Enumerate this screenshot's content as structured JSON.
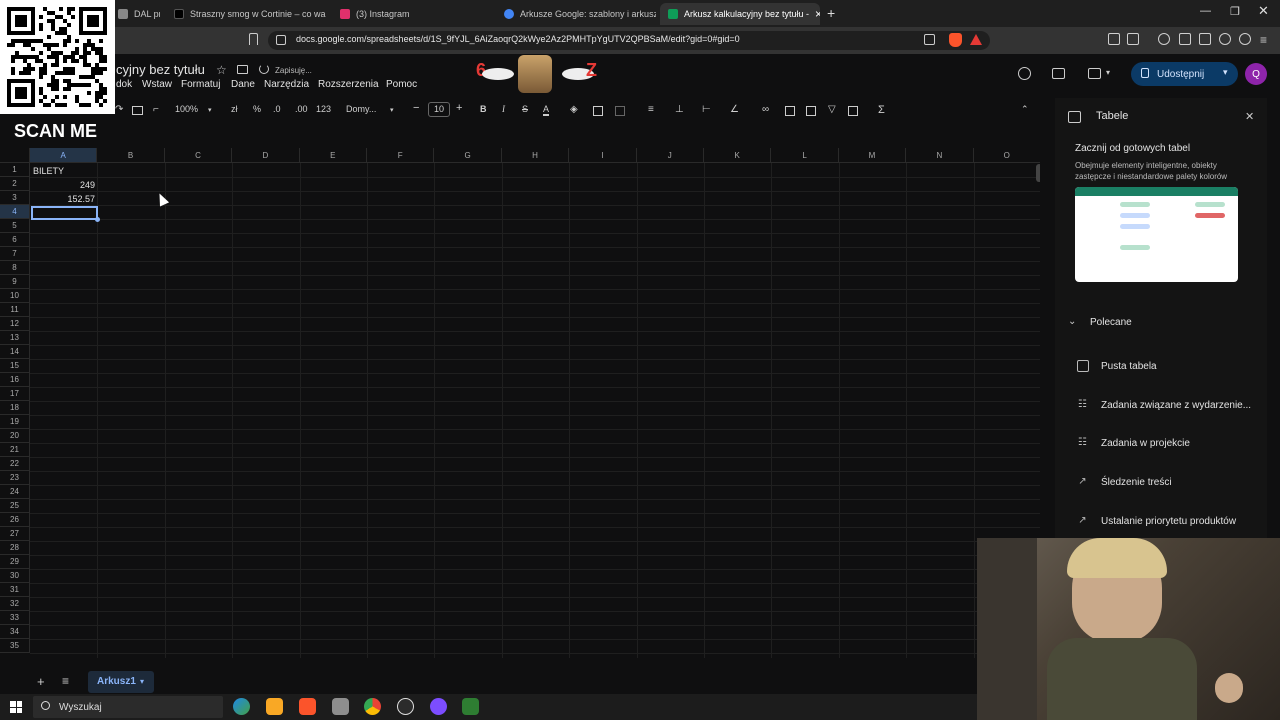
{
  "browser": {
    "tabs": [
      {
        "label": "DAL prod. (",
        "color": "#888888"
      },
      {
        "label": "Straszny smog w Cortinie – co warto",
        "color": "#000000"
      },
      {
        "label": "(3) Instagram",
        "color": "#e1306c"
      },
      {
        "label": "Arkusze Google: szablony i arkusze k",
        "color": "#4285f4"
      },
      {
        "label": "Arkusz kalkulacyjny bez tytułu - ",
        "color": "#0f9d58"
      }
    ],
    "url": "docs.google.com/spreadsheets/d/1S_9fYJL_6AiZaoqrQ2kWye2Az2PMHTpYgUTV2QPBSaM/edit?gid=0#gid=0",
    "new_tab": "+",
    "close_tab": "×"
  },
  "doc": {
    "title": "cyjny bez tytułu",
    "saving": "Zapisuję...",
    "share": "Udostępnij",
    "avatar": "Q",
    "menus": [
      "dok",
      "Wstaw",
      "Formatuj",
      "Dane",
      "Narzędzia",
      "Rozszerzenia",
      "Pomoc"
    ]
  },
  "toolbar": {
    "zoom": "100%",
    "currency": "zł",
    "percent": "%",
    "dec_minus": ".0",
    "dec_plus": ".00",
    "format123": "123",
    "font": "Domy...",
    "minus": "−",
    "font_size": "10",
    "plus": "+",
    "bold": "B",
    "italic": "I",
    "strike": "S",
    "textcolor": "A",
    "sigma": "Σ"
  },
  "grid": {
    "columns": [
      "A",
      "B",
      "C",
      "D",
      "E",
      "F",
      "G",
      "H",
      "I",
      "J",
      "K",
      "L",
      "M",
      "N",
      "O"
    ],
    "rows": [
      "1",
      "2",
      "3",
      "4",
      "5",
      "6",
      "7",
      "8",
      "9",
      "10",
      "11",
      "12",
      "13",
      "14",
      "15",
      "16",
      "17",
      "18",
      "19",
      "20",
      "21",
      "22",
      "23",
      "24",
      "25",
      "26",
      "27",
      "28",
      "29",
      "30",
      "31",
      "32",
      "33",
      "34",
      "35"
    ],
    "cells": {
      "A1": "BILETY",
      "A2": "249",
      "A3": "152.57"
    },
    "selected": "A4"
  },
  "sheet": {
    "add": "+",
    "all": "≡",
    "name": "Arkusz1"
  },
  "panel": {
    "title": "Tabele",
    "heading": "Zacznij od gotowych tabel",
    "desc": "Obejmuje elementy inteligentne, obiekty zastępcze i niestandardowe palety kolorów",
    "section": "Polecane",
    "items": [
      "Pusta tabela",
      "Zadania związane z wydarzenie...",
      "Zadania w projekcie",
      "Śledzenie treści",
      "Ustalanie priorytetu produktów"
    ]
  },
  "overlay": {
    "scan_me": "SCAN ME",
    "sticker_left": "6",
    "sticker_right": "Z"
  },
  "taskbar": {
    "search": "Wyszukaj"
  }
}
